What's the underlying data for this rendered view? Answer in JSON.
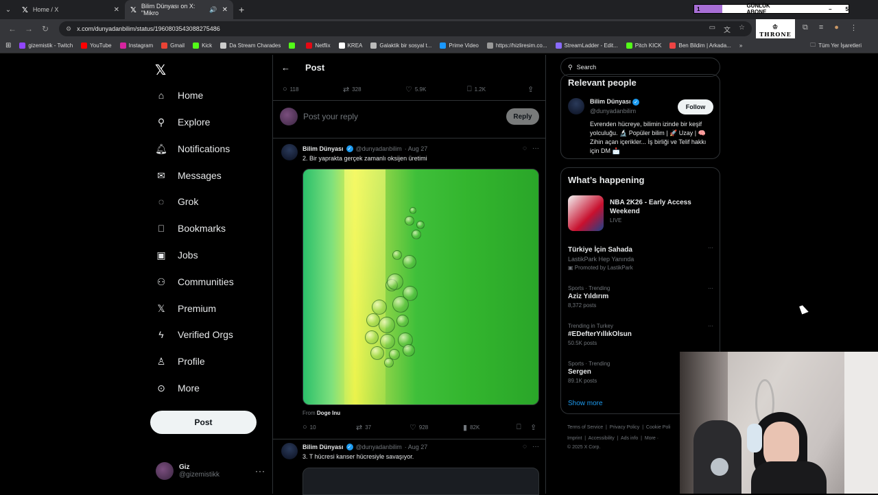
{
  "browser": {
    "tabs": [
      {
        "title": "Home / X",
        "active": false
      },
      {
        "title": "Bilim Dünyası on X: \"Mikro",
        "active": true
      }
    ],
    "overlay": {
      "left": "1",
      "center": "GÜNLÜK ABONE",
      "right_a": "–",
      "right_b": "5",
      "progress": 0.18
    },
    "url": "x.com/dunyadanbilim/status/1960803543088275486",
    "extension_logo": "THRONE",
    "bookmarks": [
      "gizemistik - Twitch",
      "YouTube",
      "Instagram",
      "Gmail",
      "Kick",
      "Da Stream Charades",
      "",
      "Netflix",
      "KREA",
      "Galaktik bir sosyal t...",
      "Prime Video",
      "https://hizliresim.co...",
      "StreamLadder - Edit...",
      "Pitch KICK",
      "Ben Bildim | Arkada..."
    ],
    "bookmarks_overflow": "»",
    "bookmarks_all": "Tüm Yer İşaretleri"
  },
  "sidebar": {
    "items": [
      "Home",
      "Explore",
      "Notifications",
      "Messages",
      "Grok",
      "Bookmarks",
      "Jobs",
      "Communities",
      "Premium",
      "Verified Orgs",
      "Profile",
      "More"
    ],
    "post_button": "Post",
    "profile": {
      "name": "Giz",
      "handle": "@gizemistikk"
    }
  },
  "main": {
    "header_title": "Post",
    "stats": {
      "replies": "118",
      "reposts": "328",
      "likes": "5.9K",
      "bookmarks": "1.2K"
    },
    "reply_placeholder": "Post your reply",
    "reply_button": "Reply",
    "tweets": [
      {
        "name": "Bilim Dünyası",
        "handle": "@dunyadanbilim",
        "date": "· Aug 27",
        "text": "2. Bir yaprakta gerçek zamanlı oksijen üretimi",
        "from_label": "From",
        "from_name": "Doge Inu",
        "replies": "10",
        "reposts": "37",
        "likes": "928",
        "views": "82K"
      },
      {
        "name": "Bilim Dünyası",
        "handle": "@dunyadanbilim",
        "date": "· Aug 27",
        "text": "3. T hücresi kanser hücresiyle savaşıyor."
      }
    ]
  },
  "right": {
    "search_placeholder": "Search",
    "relevant": {
      "title": "Relevant people",
      "name": "Bilim Dünyası",
      "handle": "@dunyadanbilim",
      "follow": "Follow",
      "bio": "Evrenden hücreye, bilimin izinde bir keşif yolculuğu. 🔬 Popüler bilim | 🚀 Uzay | 🧠 Zihin açan içerikler... İş birliği ve Telif hakkı için DM 📩"
    },
    "happening": {
      "title": "What’s happening",
      "featured": {
        "title": "NBA 2K26 - Early Access Weekend",
        "status": "LIVE"
      },
      "trends": [
        {
          "context": "",
          "title": "Türkiye İçin Sahada",
          "sub": "LastikPark Hep Yanında",
          "extra": "Promoted by LastikPark"
        },
        {
          "context": "Sports · Trending",
          "title": "Aziz Yıldırım",
          "sub": "8,372 posts",
          "extra": ""
        },
        {
          "context": "Trending in Turkey",
          "title": "#EDefterYıllıkOlsun",
          "sub": "50.5K posts",
          "extra": ""
        },
        {
          "context": "Sports · Trending",
          "title": "Sergen",
          "sub": "89.1K posts",
          "extra": ""
        }
      ],
      "show_more": "Show more"
    },
    "footer": {
      "links": [
        "Terms of Service",
        "Privacy Policy",
        "Cookie Poli"
      ],
      "links2": [
        "Imprint",
        "Accessibility",
        "Ads info",
        "More ·"
      ],
      "copyright": "© 2025 X Corp."
    }
  }
}
